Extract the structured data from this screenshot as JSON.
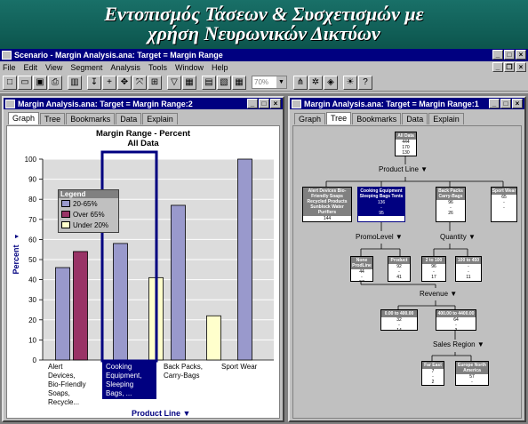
{
  "slide": {
    "title_line1": "Εντοπισμός Τάσεων & Συσχετισμών με",
    "title_line2": "χρήση Νευρωνικών Δικτύων"
  },
  "app": {
    "title": "Scenario - Margin Analysis.ana:  Target = Margin Range",
    "menu": [
      "File",
      "Edit",
      "View",
      "Segment",
      "Analysis",
      "Tools",
      "Window",
      "Help"
    ],
    "zoom": "70%"
  },
  "left_window": {
    "title": "Margin Analysis.ana:  Target = Margin Range:2",
    "tabs": [
      "Graph",
      "Tree",
      "Bookmarks",
      "Data",
      "Explain"
    ],
    "active_tab": "Graph"
  },
  "right_window": {
    "title": "Margin Analysis.ana:  Target = Margin Range:1",
    "tabs": [
      "Graph",
      "Tree",
      "Bookmarks",
      "Data",
      "Explain"
    ],
    "active_tab": "Tree"
  },
  "chart_data": {
    "type": "bar",
    "title": "Margin Range - Percent",
    "subtitle": "All Data",
    "ylabel": "Percent",
    "xlabel": "Product Line",
    "ylim": [
      0,
      100
    ],
    "yticks": [
      0,
      10,
      20,
      30,
      40,
      50,
      60,
      70,
      80,
      90,
      100
    ],
    "categories": [
      "Alert Devices, Bio-Friendly Soaps, Recycle...",
      "Cooking Equipment, Sleeping Bags, ...",
      "Back Packs, Carry-Bags",
      "Sport Wear"
    ],
    "selected_category": 1,
    "series": [
      {
        "name": "20-65%",
        "color": "#9999cc",
        "values": [
          46,
          58,
          77,
          100
        ]
      },
      {
        "name": "Over 65%",
        "color": "#993366",
        "values": [
          54,
          null,
          null,
          null
        ]
      },
      {
        "name": "Under 20%",
        "color": "#ffffcc",
        "values": [
          null,
          41,
          22,
          null
        ]
      }
    ],
    "legend_title": "Legend",
    "legend_position": "top-left"
  },
  "tree": {
    "root": {
      "label": "All Data",
      "v1": "444",
      "v2": "170",
      "v3": "130"
    },
    "split1": "Product Line",
    "level1": [
      {
        "label": "Alert Devices Bio-Friendly Soaps Recycled Products Sunblock Water Purifiers",
        "v1": "144",
        "v2": "170",
        "v3": "-"
      },
      {
        "label": "Cooking Equipment Sleeping Bags Tents",
        "v1": "136",
        "v2": "-",
        "v3": "95",
        "selected": true
      },
      {
        "label": "Back Packs Carry-Bags",
        "v1": "96",
        "v2": "-",
        "v3": "26"
      },
      {
        "label": "Sport Wear",
        "v1": "65",
        "v2": "-",
        "v3": "-"
      }
    ],
    "split_promo": "PromoLevel",
    "split_qty": "Quantity",
    "level2": [
      {
        "label": "None ProdLine",
        "v1": "44",
        "v2": "-",
        "v3": "57"
      },
      {
        "label": "Product",
        "v1": "92",
        "v2": "-",
        "v3": "41"
      },
      {
        "label": "2 to 100",
        "v1": "96",
        "v2": "-",
        "v3": "17"
      },
      {
        "label": "100 to 450",
        "v1": "-",
        "v2": "-",
        "v3": "11"
      }
    ],
    "split_rev": "Revenue",
    "level3": [
      {
        "label": "0.00 to 400.00",
        "v1": "32",
        "v2": "-",
        "v3": "14"
      },
      {
        "label": "400.00 to 4400.00",
        "v1": "64",
        "v2": "-",
        "v3": "3"
      }
    ],
    "split_region": "Sales Region",
    "level4": [
      {
        "label": "Far East",
        "v1": "7",
        "v2": "-",
        "v3": "2"
      },
      {
        "label": "Europe North America",
        "v1": "57",
        "v2": "-",
        "v3": "1"
      }
    ]
  }
}
